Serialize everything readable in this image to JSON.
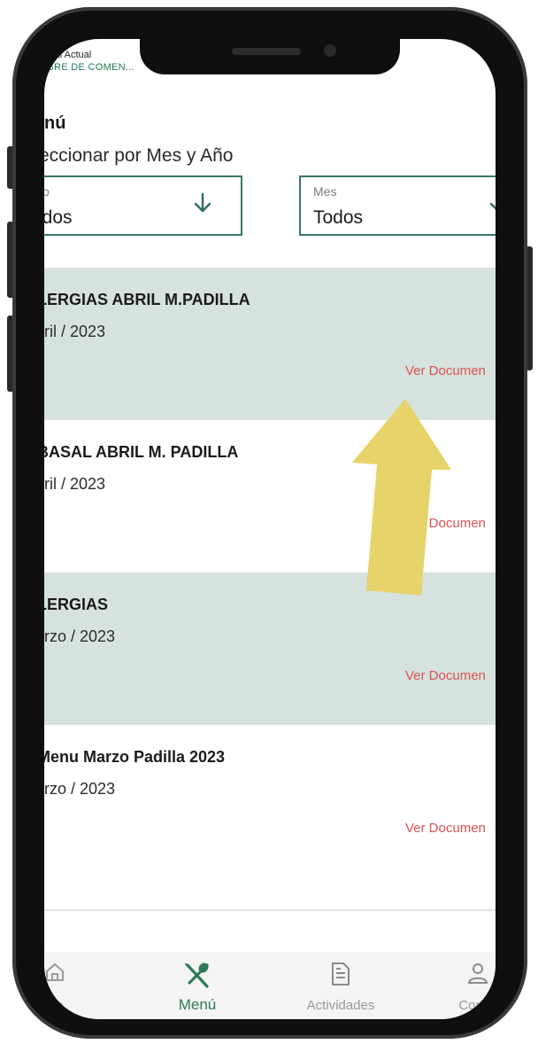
{
  "header": {
    "plan_label": "nsal Actual",
    "plan_name": "IBRE DE COMEN...",
    "page_title": "nú",
    "filter_label": "eccionar por Mes y Año"
  },
  "filters": {
    "year": {
      "label": "o",
      "value": "odos"
    },
    "month": {
      "label": "Mes",
      "value": "Todos"
    }
  },
  "documents": [
    {
      "title": "LERGIAS ABRIL M.PADILLA",
      "date": "bril / 2023",
      "link": "Ver Documen"
    },
    {
      "title": "BASAL ABRIL M. PADILLA",
      "date": "bril / 2023",
      "link": "Ver Documen"
    },
    {
      "title": "LERGIAS",
      "date": "arzo / 2023",
      "link": "Ver Documen"
    },
    {
      "title": "Menu Marzo Padilla 2023",
      "date": "arzo / 2023",
      "link": "Ver Documen"
    }
  ],
  "nav": {
    "home_label": "cio",
    "menu_label": "Menú",
    "activities_label": "Actividades",
    "config_label": "Config"
  },
  "colors": {
    "accent_green": "#2f7a58",
    "shaded_row": "#d6e2de",
    "link_red": "#d9534f",
    "annotation_yellow": "#e6d36a"
  }
}
